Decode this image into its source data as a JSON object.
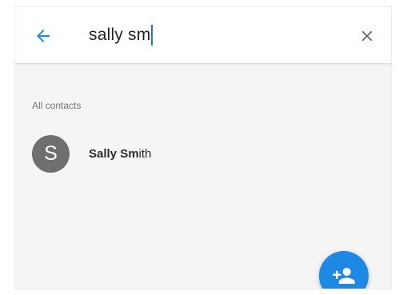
{
  "search": {
    "query": "sally sm",
    "back_icon": "arrow-back-icon",
    "clear_icon": "close-icon"
  },
  "results": {
    "section_title": "All contacts",
    "contacts": [
      {
        "initial": "S",
        "name_matched": "Sally Sm",
        "name_rest": "ith"
      }
    ]
  },
  "fab": {
    "icon": "add-person-icon"
  },
  "colors": {
    "accent": "#1e88e5",
    "avatar": "#6f6f6f",
    "background": "#f5f5f5"
  }
}
